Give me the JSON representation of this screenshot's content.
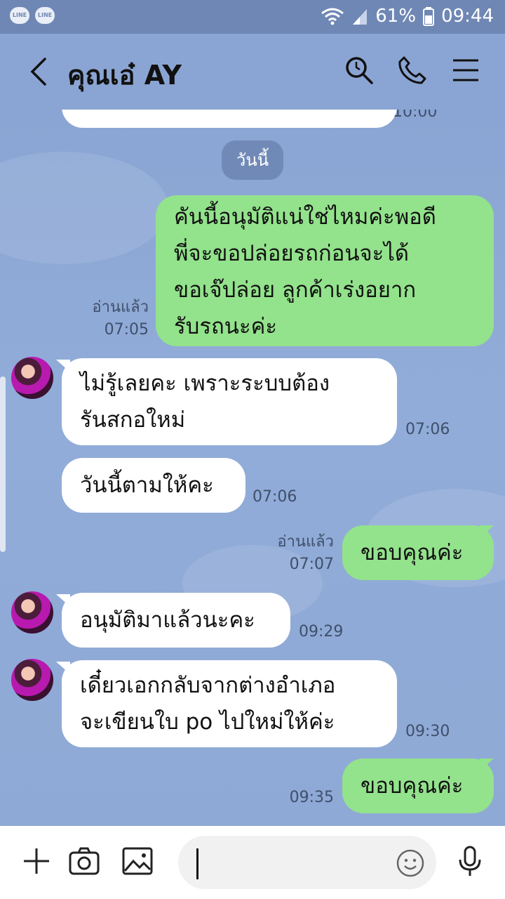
{
  "status_bar": {
    "app_badges": [
      "LINE",
      "LINE"
    ],
    "battery": "61%",
    "time": "09:44"
  },
  "header": {
    "title": "คุณเอ๋ AY"
  },
  "chat": {
    "partial_top_time": "10:00",
    "date_separator": "วันนี้",
    "messages": [
      {
        "side": "out",
        "lines": [
          "คันนี้อนุมัติแน่ใช่ไหมค่ะพอดี",
          "พี่จะขอปล่อยรถก่อนจะได้",
          "ขอเจ๊ปล่อย ลูกค้าเร่งอยาก",
          "รับรถนะค่ะ"
        ],
        "read": "อ่านแล้ว",
        "time": "07:05"
      },
      {
        "side": "in",
        "lines": [
          "ไม่รู้เลยคะ เพราะระบบต้อง",
          "รันสกอใหม่"
        ],
        "time": "07:06"
      },
      {
        "side": "in",
        "lines": [
          "วันนี้ตามให้คะ"
        ],
        "time": "07:06"
      },
      {
        "side": "out",
        "lines": [
          "ขอบคุณค่ะ"
        ],
        "read": "อ่านแล้ว",
        "time": "07:07"
      },
      {
        "side": "in",
        "lines": [
          "อนุมัติมาแล้วนะคะ"
        ],
        "time": "09:29"
      },
      {
        "side": "in",
        "lines": [
          "เดี๋ยวเอกกลับจากต่างอำเภอ",
          "จะเขียนใบ po ไปใหม่ให้ค่ะ"
        ],
        "time": "09:30"
      },
      {
        "side": "out",
        "lines": [
          "ขอบคุณค่ะ"
        ],
        "time": "09:35"
      }
    ]
  },
  "colors": {
    "background": "#8aa5d3",
    "outgoing_bubble": "#93e28c",
    "incoming_bubble": "#ffffff"
  },
  "icons": {
    "header": [
      "back-icon",
      "search-icon",
      "phone-icon",
      "menu-icon"
    ],
    "input": [
      "plus-icon",
      "camera-icon",
      "image-icon",
      "emoji-icon",
      "microphone-icon"
    ]
  }
}
